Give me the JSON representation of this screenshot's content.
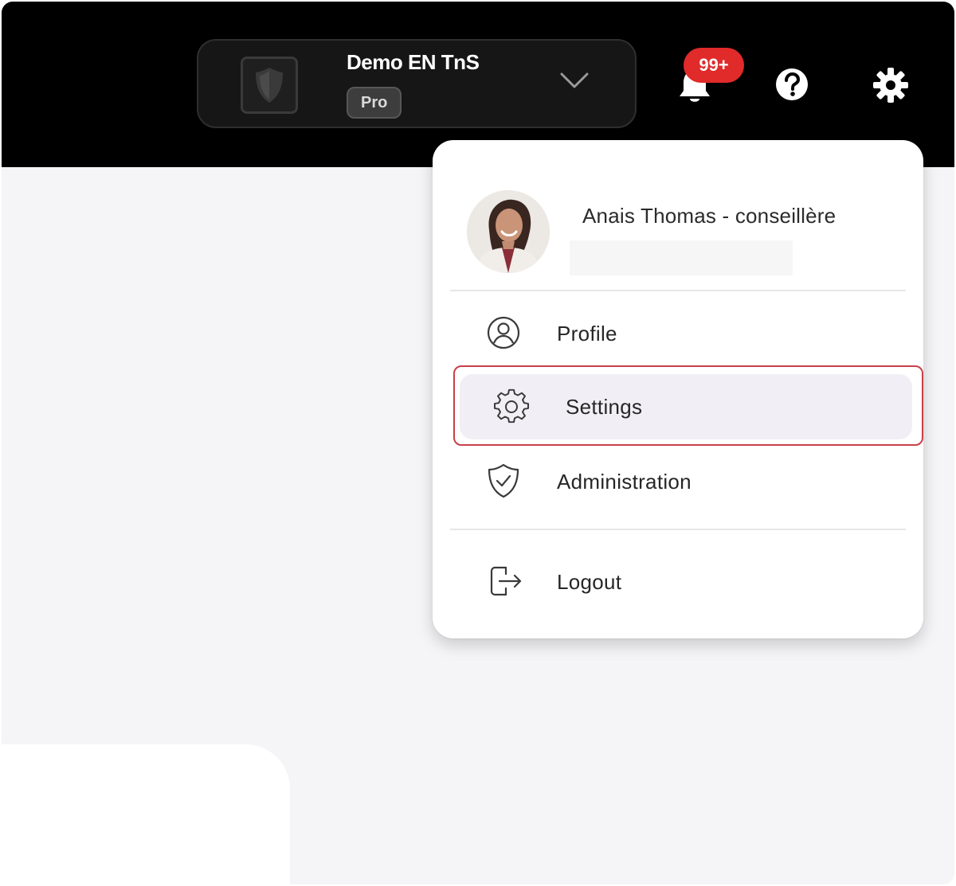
{
  "header": {
    "org_name": "Demo EN TnS",
    "plan_badge": "Pro",
    "notifications_count": "99+"
  },
  "user_menu": {
    "user_name": "Anais Thomas - conseillère",
    "items": [
      {
        "label": "Profile",
        "icon": "user-circle-icon"
      },
      {
        "label": "Settings",
        "icon": "gear-icon",
        "active": true
      },
      {
        "label": "Administration",
        "icon": "shield-check-icon"
      },
      {
        "label": "Logout",
        "icon": "logout-icon"
      }
    ]
  },
  "colors": {
    "topbar": "#000000",
    "badge_red": "#e12a2a",
    "highlight_red": "#c8404a",
    "active_item_bg": "#f1eff5",
    "page_bg": "#f5f5f7"
  }
}
